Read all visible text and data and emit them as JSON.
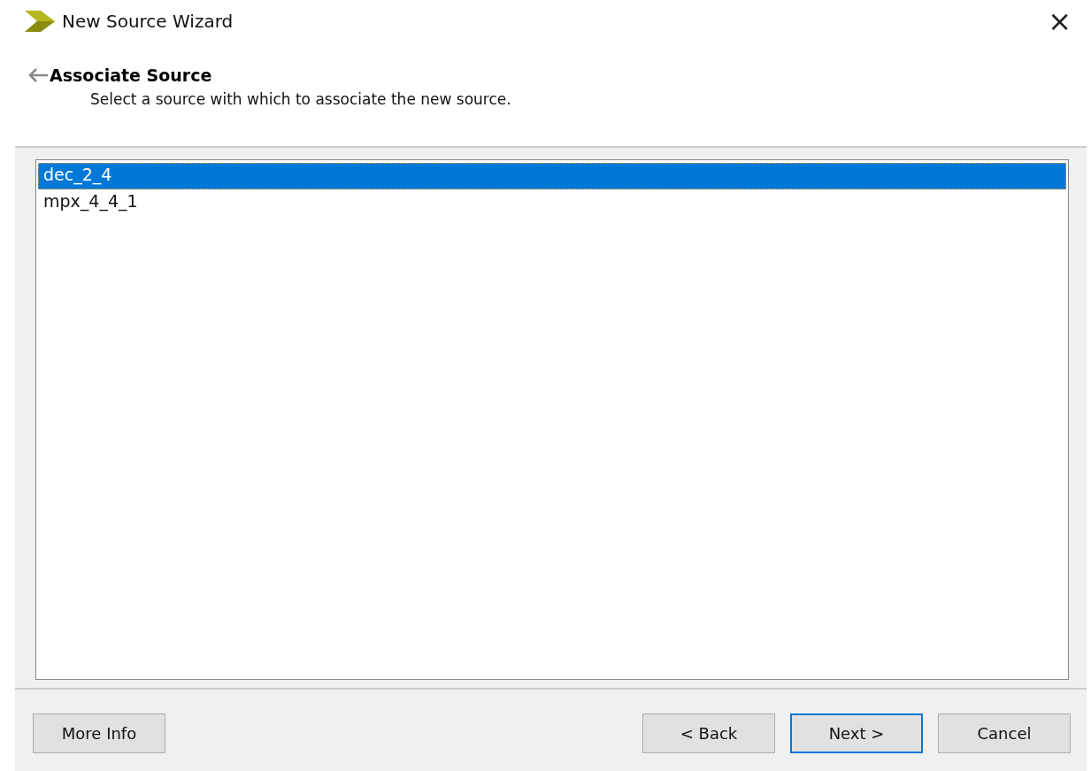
{
  "window": {
    "title": "New Source Wizard",
    "close": "×"
  },
  "header": {
    "title": "Associate Source",
    "subtitle": "Select a source with which to associate the new source."
  },
  "sources": [
    {
      "label": "dec_2_4",
      "selected": true
    },
    {
      "label": "mpx_4_4_1",
      "selected": false
    }
  ],
  "buttons": [
    {
      "label": "More Info",
      "kind": "left",
      "default": false
    },
    {
      "label": "< Back",
      "kind": "right",
      "default": false
    },
    {
      "label": "Next >",
      "kind": "right",
      "default": true
    },
    {
      "label": "Cancel",
      "kind": "right",
      "default": false
    }
  ]
}
